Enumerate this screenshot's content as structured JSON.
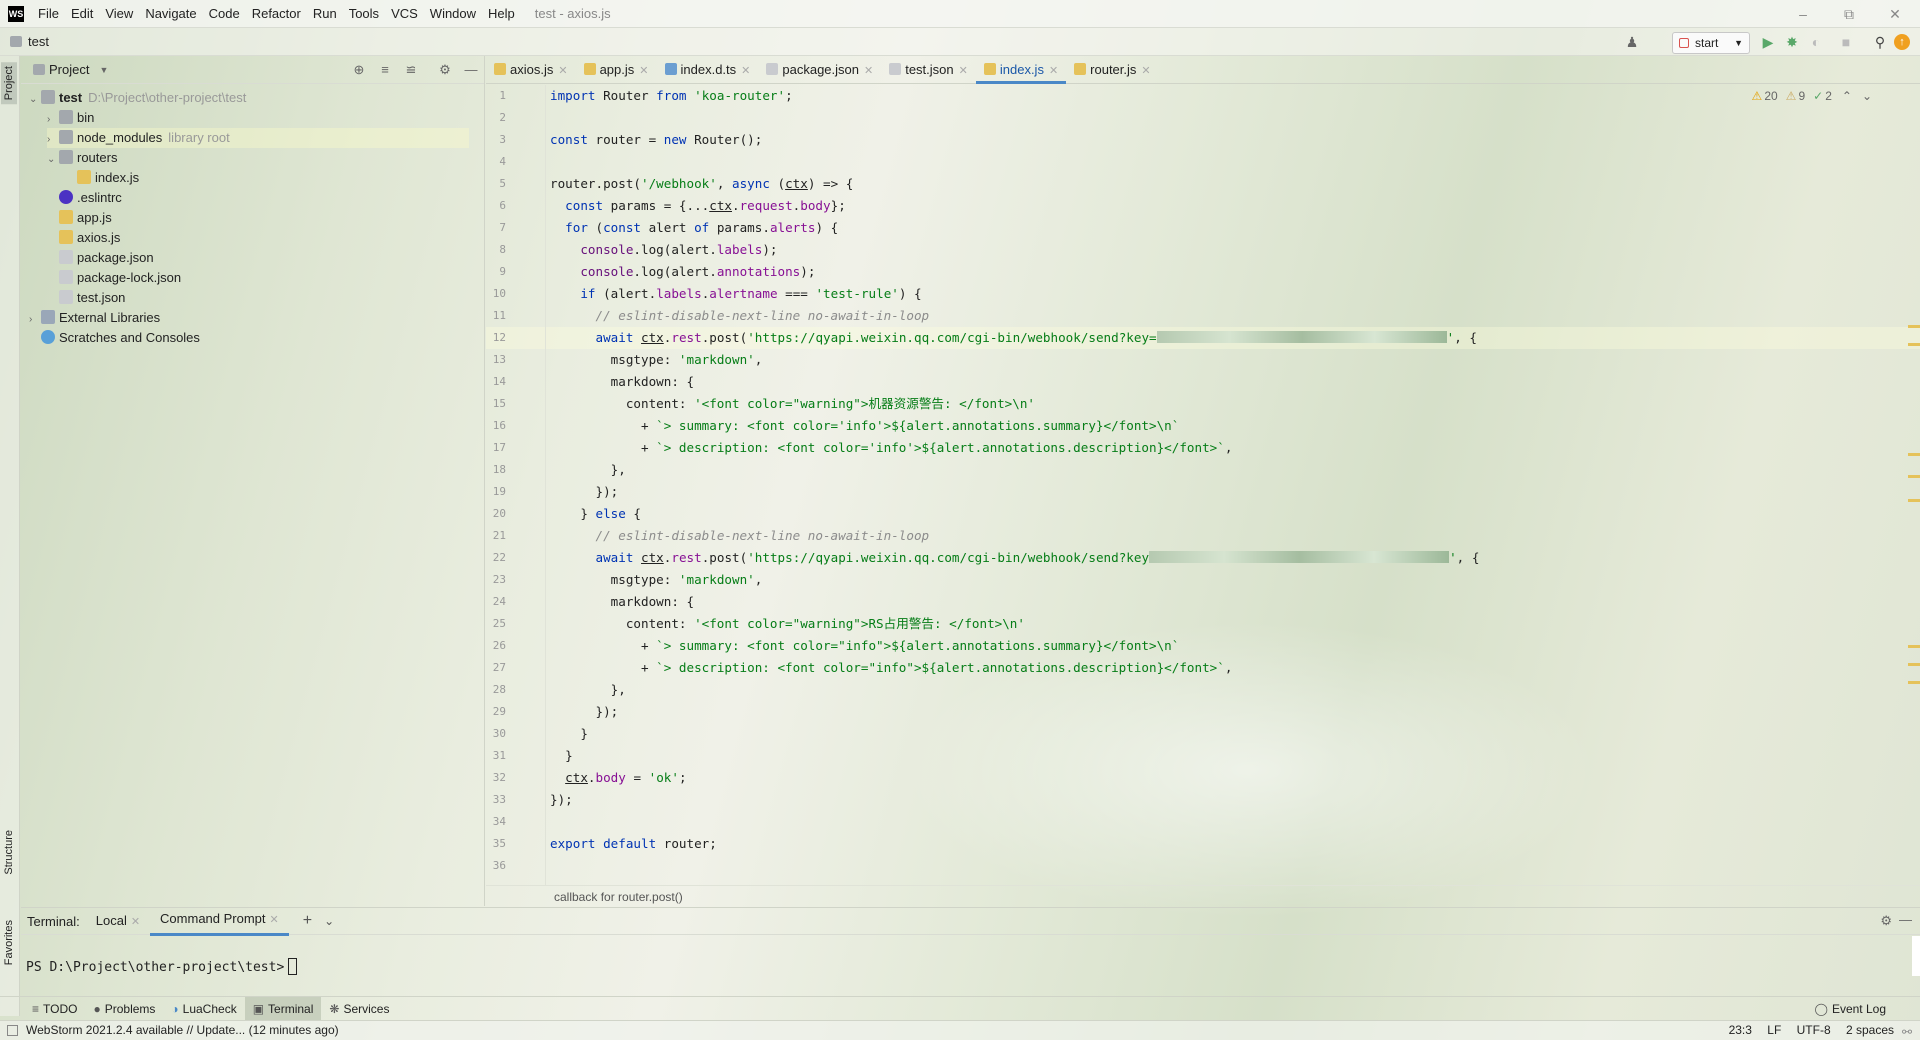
{
  "menubar": {
    "logo": "WS",
    "items": [
      "File",
      "Edit",
      "View",
      "Navigate",
      "Code",
      "Refactor",
      "Run",
      "Tools",
      "VCS",
      "Window",
      "Help"
    ],
    "window_title": "test - axios.js"
  },
  "navbar": {
    "project": "test",
    "run_config": "start"
  },
  "side": {
    "project": "Project",
    "structure": "Structure",
    "favorites": "Favorites"
  },
  "project": {
    "title": "Project",
    "tree": [
      {
        "label": "test",
        "hint": "D:\\Project\\other-project\\test",
        "depth": 0,
        "arrow": "v",
        "icon": "folder",
        "bold": true
      },
      {
        "label": "bin",
        "depth": 1,
        "arrow": ">",
        "icon": "folder"
      },
      {
        "label": "node_modules",
        "hint": "library root",
        "depth": 1,
        "arrow": ">",
        "icon": "folder"
      },
      {
        "label": "routers",
        "depth": 1,
        "arrow": "v",
        "icon": "folder"
      },
      {
        "label": "index.js",
        "depth": 2,
        "arrow": "",
        "icon": "js"
      },
      {
        "label": ".eslintrc",
        "depth": 1,
        "arrow": "",
        "icon": "eslint"
      },
      {
        "label": "app.js",
        "depth": 1,
        "arrow": "",
        "icon": "js"
      },
      {
        "label": "axios.js",
        "depth": 1,
        "arrow": "",
        "icon": "js"
      },
      {
        "label": "package.json",
        "depth": 1,
        "arrow": "",
        "icon": "json"
      },
      {
        "label": "package-lock.json",
        "depth": 1,
        "arrow": "",
        "icon": "json"
      },
      {
        "label": "test.json",
        "depth": 1,
        "arrow": "",
        "icon": "json"
      },
      {
        "label": "External Libraries",
        "depth": 0,
        "arrow": ">",
        "icon": "lib"
      },
      {
        "label": "Scratches and Consoles",
        "depth": 0,
        "arrow": "",
        "icon": "scratch"
      }
    ]
  },
  "tabs": [
    {
      "label": "axios.js",
      "icon": "js",
      "active": false
    },
    {
      "label": "app.js",
      "icon": "js",
      "active": false
    },
    {
      "label": "index.d.ts",
      "icon": "ts",
      "active": false
    },
    {
      "label": "package.json",
      "icon": "json",
      "active": false
    },
    {
      "label": "test.json",
      "icon": "json",
      "active": false
    },
    {
      "label": "index.js",
      "icon": "js",
      "active": true
    },
    {
      "label": "router.js",
      "icon": "js",
      "active": false
    }
  ],
  "inspections": {
    "warnings": "20",
    "weak": "9",
    "ok": "2"
  },
  "editor": {
    "lines": [
      "import Router from 'koa-router';",
      "",
      "const router = new Router();",
      "",
      "router.post('/webhook', async (ctx) => {",
      "  const params = {...ctx.request.body};",
      "  for (const alert of params.alerts) {",
      "    console.log(alert.labels);",
      "    console.log(alert.annotations);",
      "    if (alert.labels.alertname === 'test-rule') {",
      "      // eslint-disable-next-line no-await-in-loop",
      "      await ctx.rest.post('https://qyapi.weixin.qq.com/cgi-bin/webhook/send?key=",
      "        msgtype: 'markdown',",
      "        markdown: {",
      "          content: '<font color=\"warning\">机器资源警告: </font>\\n'",
      "            + `> summary: <font color='info'>${alert.annotations.summary}</font>\\n`",
      "            + `> description: <font color='info'>${alert.annotations.description}</font>`,",
      "        },",
      "      });",
      "    } else {",
      "      // eslint-disable-next-line no-await-in-loop",
      "      await ctx.rest.post('https://qyapi.weixin.qq.com/cgi-bin/webhook/send?key",
      "        msgtype: 'markdown',",
      "        markdown: {",
      "          content: '<font color=\"warning\">RS占用警告: </font>\\n'",
      "            + `> summary: <font color=\"info\">${alert.annotations.summary}</font>\\n`",
      "            + `> description: <font color=\"info\">${alert.annotations.description}</font>`,",
      "        },",
      "      });",
      "    }",
      "  }",
      "  ctx.body = 'ok';",
      "});",
      "",
      "export default router;",
      ""
    ],
    "line_count": 36,
    "breadcrumb": "callback for router.post()"
  },
  "terminal": {
    "label": "Terminal:",
    "tabs": [
      "Local",
      "Command Prompt"
    ],
    "prompt": "PS D:\\Project\\other-project\\test>"
  },
  "toolwindows": [
    "TODO",
    "Problems",
    "LuaCheck",
    "Terminal",
    "Services"
  ],
  "event_log": "Event Log",
  "status": {
    "message": "WebStorm 2021.2.4 available // Update... (12 minutes ago)",
    "position": "23:3",
    "line_sep": "LF",
    "encoding": "UTF-8",
    "indent": "2 spaces"
  },
  "colors": {
    "accent": "#4a88c7",
    "keyword": "#0033b3",
    "string": "#067d17",
    "comment": "#8c8c8c",
    "run": "#59a869"
  }
}
